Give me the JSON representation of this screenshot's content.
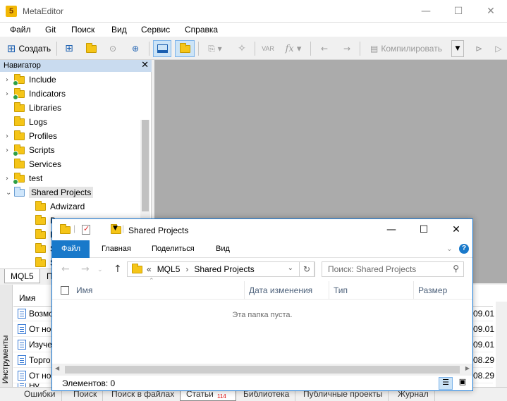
{
  "app": {
    "title": "MetaEditor"
  },
  "menu": [
    "Файл",
    "Git",
    "Поиск",
    "Вид",
    "Сервис",
    "Справка"
  ],
  "toolbar": {
    "create_label": "Создать",
    "compile_label": "Компилировать"
  },
  "navigator": {
    "title": "Навигатор",
    "items": [
      {
        "label": "Include",
        "expandable": true,
        "synced": true
      },
      {
        "label": "Indicators",
        "expandable": true,
        "synced": true
      },
      {
        "label": "Libraries",
        "expandable": false,
        "synced": false
      },
      {
        "label": "Logs",
        "expandable": false,
        "synced": false
      },
      {
        "label": "Profiles",
        "expandable": true,
        "synced": false
      },
      {
        "label": "Scripts",
        "expandable": true,
        "synced": true
      },
      {
        "label": "Services",
        "expandable": false,
        "synced": false
      },
      {
        "label": "test",
        "expandable": true,
        "synced": true
      },
      {
        "label": "Shared Projects",
        "expanded": true,
        "selected": true
      }
    ],
    "subitems": [
      "Adwizard",
      "B",
      "D",
      "S",
      "S"
    ],
    "tabs": [
      "MQL5",
      "П"
    ]
  },
  "toolbox": {
    "side_label": "Инструменты",
    "header": "Имя",
    "rows": [
      {
        "name": "Возмо",
        "date": "09.01"
      },
      {
        "name": "От но",
        "date": "09.01"
      },
      {
        "name": "Изуче",
        "date": "09.01"
      },
      {
        "name": "Торго",
        "date": "08.29"
      },
      {
        "name": "От но",
        "date": "08.29"
      },
      {
        "name": "Ну",
        "date": ""
      }
    ],
    "tabs": [
      "Ошибки",
      "Поиск",
      "Поиск в файлах",
      "Статьи",
      "Библиотека",
      "Публичные проекты",
      "Журнал"
    ],
    "articles_badge": "114"
  },
  "explorer": {
    "title": "Shared Projects",
    "ribbon": [
      "Файл",
      "Главная",
      "Поделиться",
      "Вид"
    ],
    "address": {
      "prefix": "«",
      "root": "MQL5",
      "separator": "›",
      "current": "Shared Projects"
    },
    "search_placeholder": "Поиск: Shared Projects",
    "columns": [
      "Имя",
      "Дата изменения",
      "Тип",
      "Размер"
    ],
    "empty_text": "Эта папка пуста.",
    "status": "Элементов: 0"
  }
}
